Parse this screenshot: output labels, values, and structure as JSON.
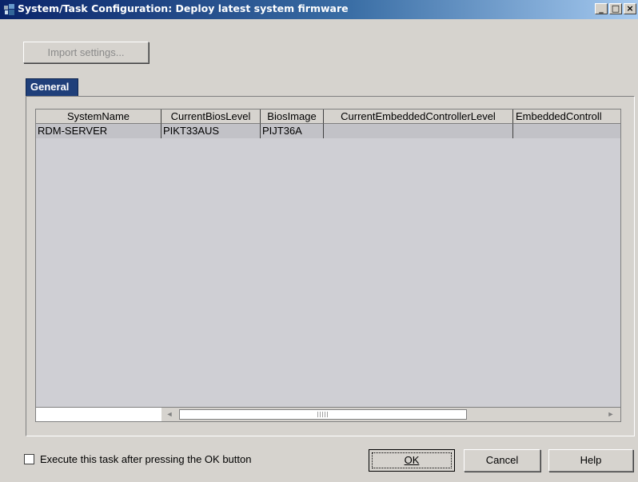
{
  "window": {
    "title": "System/Task Configuration: Deploy latest system firmware",
    "minimize": "_",
    "maximize": "□",
    "close": "×"
  },
  "toolbar": {
    "import_label": "Import settings..."
  },
  "tab": {
    "label": "General"
  },
  "table": {
    "columns": [
      "SystemName",
      "CurrentBiosLevel",
      "BiosImage",
      "CurrentEmbeddedControllerLevel",
      "EmbeddedControll"
    ],
    "rows": [
      [
        "RDM-SERVER",
        "PIKT33AUS",
        "PIJT36A",
        "",
        ""
      ]
    ]
  },
  "scrollbar": {
    "left_arrow": "◄",
    "right_arrow": "►"
  },
  "footer": {
    "checkbox_label": "Execute this task after pressing the OK button",
    "ok_label": "OK",
    "cancel_label": "Cancel",
    "help_label": "Help"
  },
  "colors": {
    "title_start": "#0a246a",
    "title_end": "#a6caf0",
    "tab": "#1f3f7a"
  }
}
